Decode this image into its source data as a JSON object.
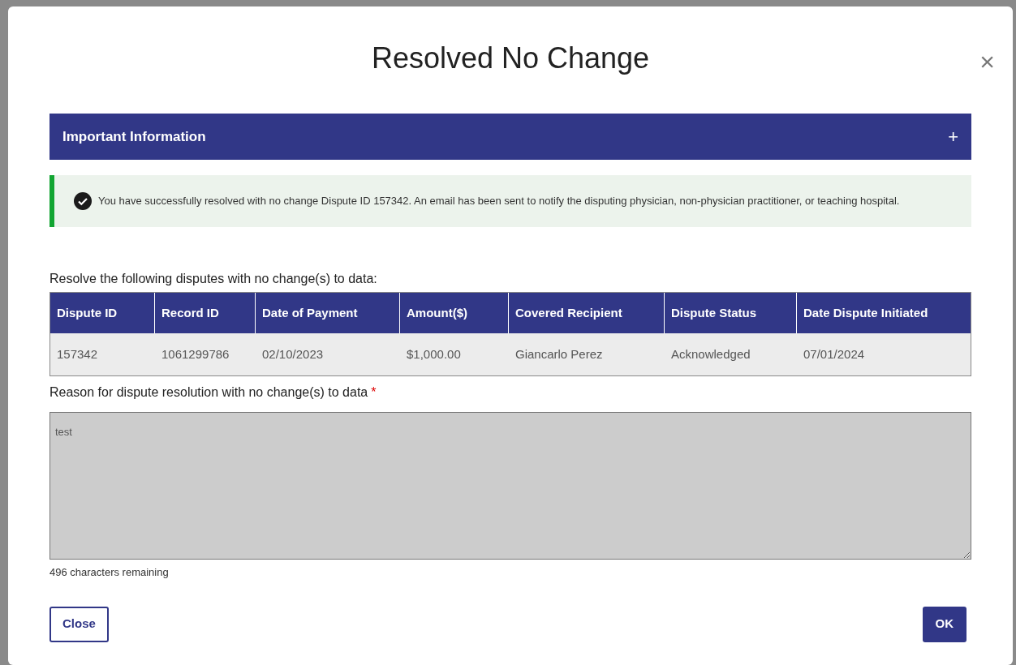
{
  "dialog": {
    "title": "Resolved No Change",
    "close_symbol": "×"
  },
  "info_panel": {
    "title": "Important Information",
    "expanded": false,
    "toggle_symbol": "+"
  },
  "alert": {
    "kind": "success",
    "message": "You have successfully resolved with no change Dispute ID 157342. An email has been sent to notify the disputing physician, non-physician practitioner, or teaching hospital."
  },
  "table": {
    "caption": "Resolve the following disputes with no change(s) to data:",
    "columns": [
      "Dispute ID",
      "Record ID",
      "Date of Payment",
      "Amount($)",
      "Covered Recipient",
      "Dispute Status",
      "Date Dispute Initiated"
    ],
    "rows": [
      [
        "157342",
        "1061299786",
        "02/10/2023",
        "$1,000.00",
        "Giancarlo Perez",
        "Acknowledged",
        "07/01/2024"
      ]
    ]
  },
  "reason": {
    "label": "Reason for dispute resolution with no change(s) to data",
    "required_mark": "*",
    "value": "test",
    "disabled": true,
    "counter": "496 characters remaining"
  },
  "buttons": [
    {
      "label": "Close",
      "kind": "secondary"
    },
    {
      "label": "OK",
      "kind": "primary"
    }
  ]
}
